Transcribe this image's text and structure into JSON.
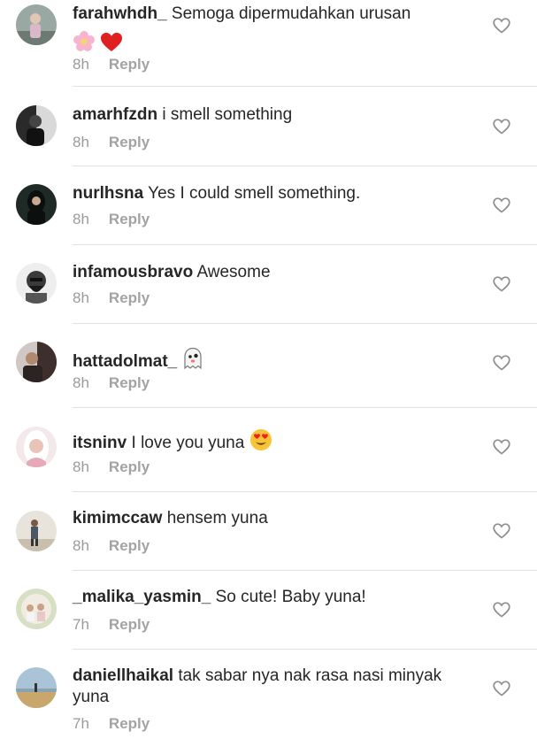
{
  "comments": [
    {
      "username": "farahwhdh_",
      "text": "Semoga dipermudahkan urusan",
      "time": "8h",
      "reply": "Reply",
      "emoji": [
        "flower-emoji",
        "red-heart-emoji"
      ]
    },
    {
      "username": "amarhfzdn",
      "text": "i smell something",
      "time": "8h",
      "reply": "Reply"
    },
    {
      "username": "nurlhsna",
      "text": "Yes I could smell something.",
      "time": "8h",
      "reply": "Reply"
    },
    {
      "username": "infamousbravo",
      "text": "Awesome",
      "time": "8h",
      "reply": "Reply"
    },
    {
      "username": "hattadolmat_",
      "text": "",
      "time": "8h",
      "reply": "Reply",
      "emoji": [
        "ghost-emoji"
      ]
    },
    {
      "username": "itsninv",
      "text": "I love you yuna",
      "time": "8h",
      "reply": "Reply",
      "emoji": [
        "heart-eyes-emoji"
      ]
    },
    {
      "username": "kimimccaw",
      "text": "hensem yuna",
      "time": "8h",
      "reply": "Reply"
    },
    {
      "username": "_malika_yasmin_",
      "text": "So cute! Baby yuna!",
      "time": "7h",
      "reply": "Reply"
    },
    {
      "username": "daniellhaikal",
      "text": "tak sabar nya nak rasa nasi minyak yuna",
      "time": "7h",
      "reply": "Reply"
    }
  ],
  "colors": {
    "text": "#262626",
    "meta": "#9b9b9b",
    "divider": "#e2e2e2",
    "heart_outline": "#8e8e8e"
  },
  "icons": {
    "like": "heart-outline-icon"
  }
}
